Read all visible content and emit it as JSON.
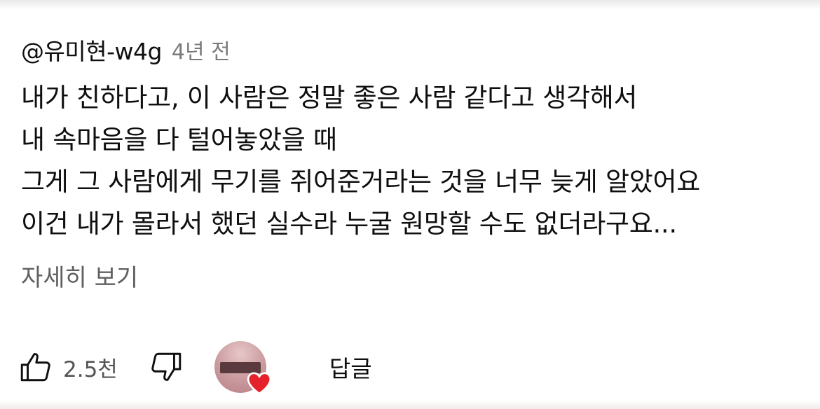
{
  "comment": {
    "author": "@유미현-w4g",
    "time": "4년 전",
    "lines": [
      "내가 친하다고, 이 사람은 정말 좋은 사람 같다고 생각해서",
      "내 속마음을 다 털어놓았을 때",
      "그게 그 사람에게 무기를 쥐어준거라는 것을 너무 늦게 알았어요",
      "이건 내가 몰라서 했던 실수라 누굴 원망할 수도 없더라구요..."
    ],
    "read_more": "자세히 보기"
  },
  "actions": {
    "like_icon": "thumbs-up-icon",
    "like_count": "2.5천",
    "dislike_icon": "thumbs-down-icon",
    "creator_heart_icon": "heart-icon",
    "reply_label": "답글"
  },
  "colors": {
    "text": "#0f0f0f",
    "secondary": "#606060",
    "heart": "#e5222b"
  }
}
